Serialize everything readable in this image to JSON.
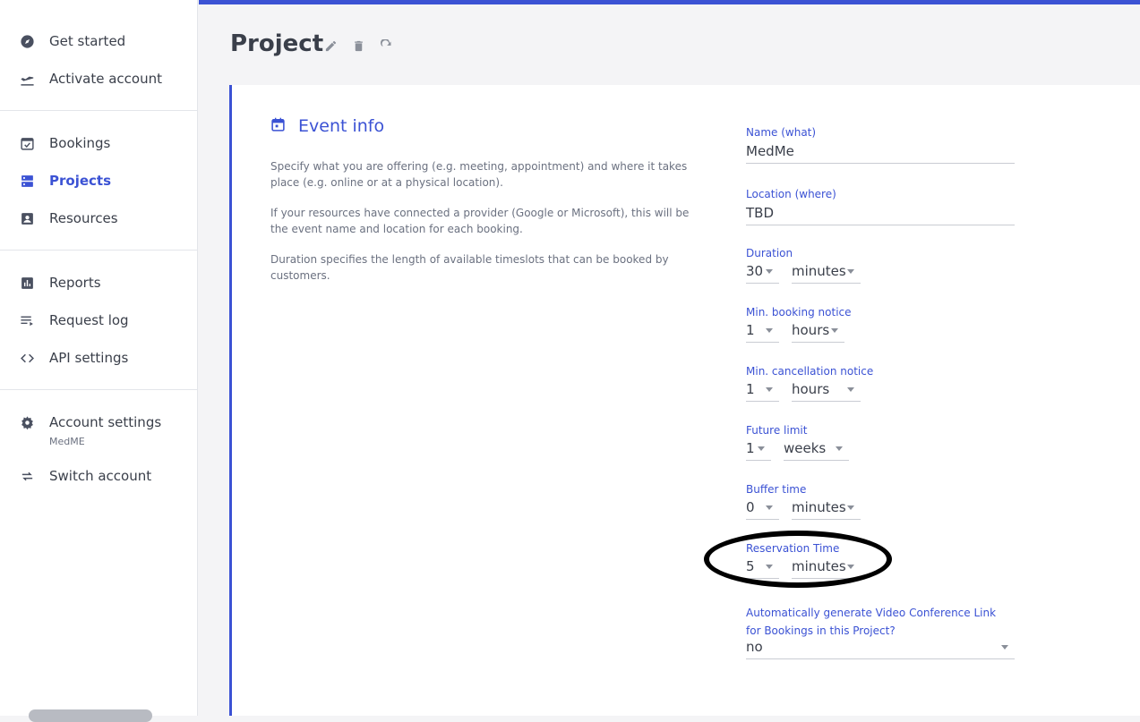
{
  "sidebar": {
    "items": [
      {
        "label": "Get started",
        "icon": "compass-icon"
      },
      {
        "label": "Activate account",
        "icon": "airplane-departure-icon"
      },
      {
        "label": "Bookings",
        "icon": "calendar-check-icon"
      },
      {
        "label": "Projects",
        "icon": "server-stack-icon",
        "active": true
      },
      {
        "label": "Resources",
        "icon": "contact-card-icon"
      },
      {
        "label": "Reports",
        "icon": "bar-chart-icon"
      },
      {
        "label": "Request log",
        "icon": "list-log-icon"
      },
      {
        "label": "API settings",
        "icon": "code-brackets-icon"
      },
      {
        "label": "Account settings",
        "icon": "gear-icon",
        "sublabel": "MedME"
      },
      {
        "label": "Switch account",
        "icon": "swap-arrows-icon"
      }
    ]
  },
  "header": {
    "title": "Project",
    "icons": [
      "pencil-icon",
      "trash-icon",
      "refresh-icon"
    ]
  },
  "card": {
    "title": "Event info",
    "icon": "calendar-icon",
    "descriptions": [
      "Specify what you are offering (e.g. meeting, appointment) and where it takes place (e.g. online or at a physical location).",
      "If your resources have connected a provider (Google or Microsoft), this will be the event name and location for each booking.",
      "Duration specifies the length of available timeslots that can be booked by customers."
    ]
  },
  "form": {
    "name": {
      "label": "Name (what)",
      "value": "MedMe"
    },
    "location": {
      "label": "Location (where)",
      "value": "TBD"
    },
    "duration": {
      "label": "Duration",
      "amount": "30",
      "unit": "minutes"
    },
    "min_booking": {
      "label": "Min. booking notice",
      "amount": "1",
      "unit": "hours"
    },
    "min_cancellation": {
      "label": "Min. cancellation notice",
      "amount": "1",
      "unit": "hours"
    },
    "future_limit": {
      "label": "Future limit",
      "amount": "1",
      "unit": "weeks"
    },
    "buffer": {
      "label": "Buffer time",
      "amount": "0",
      "unit": "minutes"
    },
    "reservation": {
      "label": "Reservation Time",
      "amount": "5",
      "unit": "minutes"
    },
    "video_link": {
      "label": "Automatically generate Video Conference Link for Bookings in this Project?",
      "value": "no"
    }
  },
  "colors": {
    "accent": "#3b52d4",
    "text": "#3a3f4a",
    "muted": "#6b7180",
    "annotation": "#000000"
  }
}
